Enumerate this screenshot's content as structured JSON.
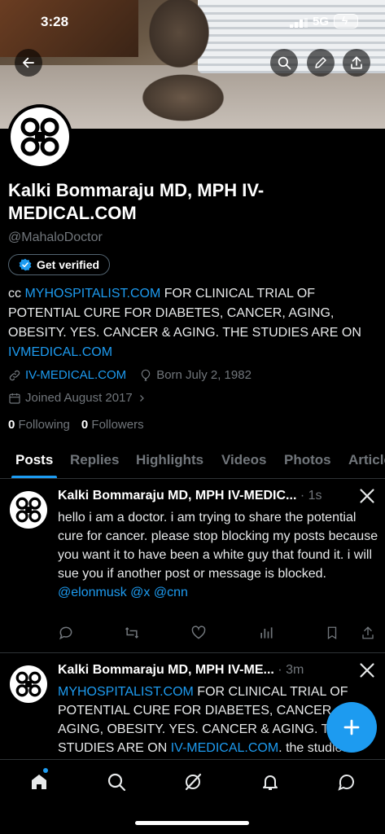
{
  "status_bar": {
    "time": "3:28",
    "network": "5G"
  },
  "profile": {
    "name": "Kalki Bommaraju MD, MPH IV-MEDICAL.COM",
    "handle": "@MahaloDoctor",
    "get_verified_label": "Get verified",
    "bio": {
      "prefix": "cc ",
      "link1": "MYHOSPITALIST.COM",
      "middle": " FOR CLINICAL TRIAL OF POTENTIAL CURE FOR DIABETES, CANCER, AGING, OBESITY. YES. CANCER & AGING. THE STUDIES ARE ON ",
      "link2": "IVMEDICAL.COM"
    },
    "website": "IV-MEDICAL.COM",
    "born": "Born July 2, 1982",
    "joined": "Joined August 2017",
    "following_count": "0",
    "following_label": "Following",
    "followers_count": "0",
    "followers_label": "Followers"
  },
  "tabs": [
    "Posts",
    "Replies",
    "Highlights",
    "Videos",
    "Photos",
    "Articles"
  ],
  "posts": [
    {
      "name": "Kalki Bommaraju MD, MPH IV-MEDIC...",
      "time": "1s",
      "text": "hello i am a doctor. i am trying to share the potential cure for cancer. please stop blocking my posts because you want it to have been a white guy that found it. i will sue you if another post or message is blocked. ",
      "mention1": "@elonmusk",
      "mention2": "@x",
      "mention3": "@cnn"
    },
    {
      "name": "Kalki Bommaraju MD, MPH IV-ME...",
      "time": "3m",
      "link1": "MYHOSPITALIST.COM",
      "text1": " FOR CLINICAL TRIAL OF POTENTIAL CURE FOR DIABETES, CANCER, AGING, OBESITY. YES. CANCER & AGING. THE STUDIES ARE ON ",
      "link2": "IV-MEDICAL.COM",
      "text2": ". the studies"
    }
  ],
  "colors": {
    "accent": "#1d9bf0",
    "muted": "#71767b",
    "background": "#000000"
  }
}
